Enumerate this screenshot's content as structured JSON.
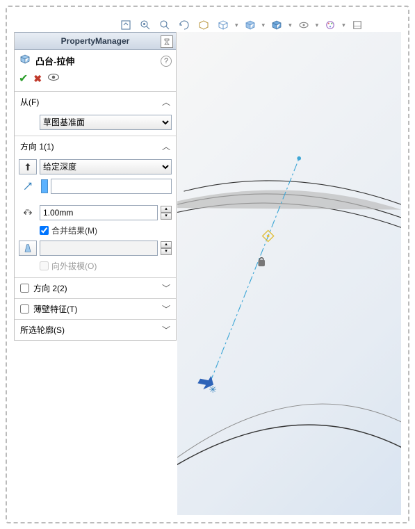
{
  "pm": {
    "title": "PropertyManager"
  },
  "feature": {
    "title": "凸台-拉伸"
  },
  "sec_from": {
    "label": "从(F)",
    "options": [
      "草图基准面"
    ],
    "selected": "草图基准面"
  },
  "sec_dir1": {
    "label": "方向 1(1)",
    "end_options": [
      "给定深度"
    ],
    "end_selected": "给定深度",
    "distance": "1.00mm",
    "merge_label": "合并结果(M)",
    "merge_checked": true,
    "draft_value": "",
    "draft_outward_label": "向外拔模(O)",
    "draft_outward_checked": false,
    "color_value": ""
  },
  "sec_dir2": {
    "label": "方向 2(2)",
    "checked": false
  },
  "sec_thin": {
    "label": "薄壁特征(T)",
    "checked": false
  },
  "sec_contours": {
    "label": "所选轮廓(S)"
  }
}
